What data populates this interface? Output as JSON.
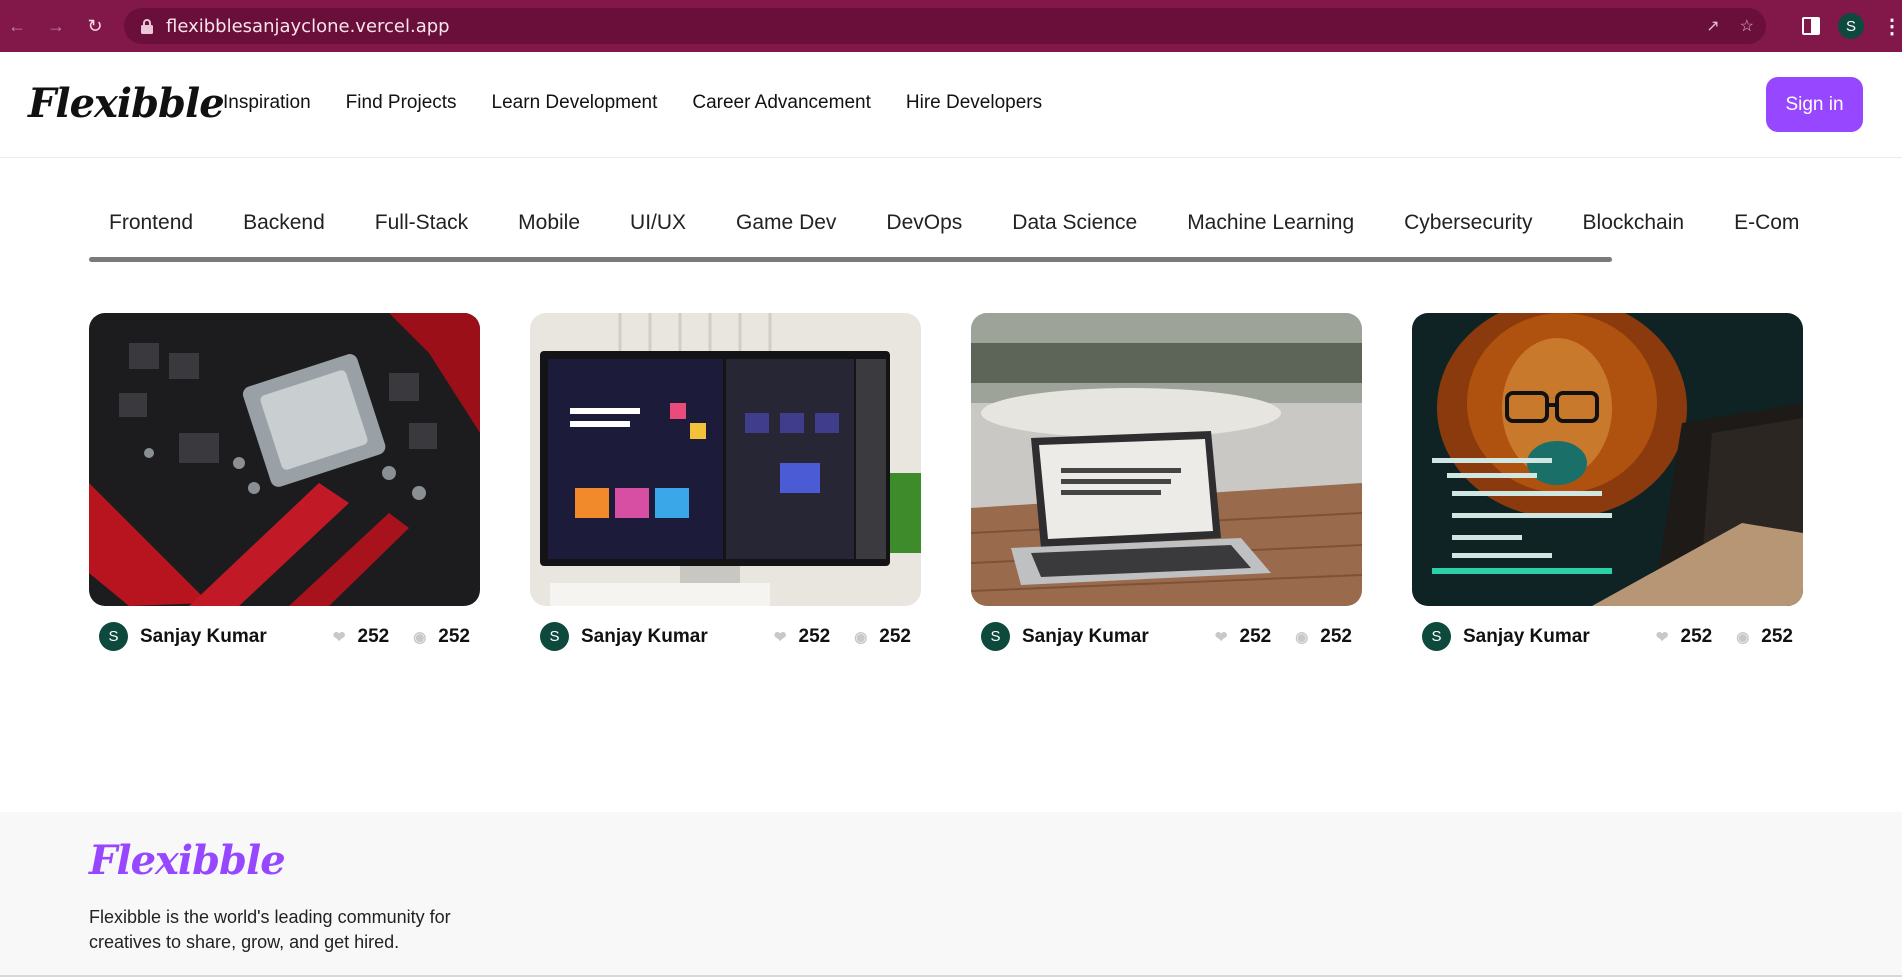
{
  "browser": {
    "url": "flexibblesanjayclone.vercel.app",
    "profile_initial": "S"
  },
  "header": {
    "logo": "Flexibble",
    "nav": [
      "Inspiration",
      "Find Projects",
      "Learn Development",
      "Career Advancement",
      "Hire Developers"
    ],
    "signin_label": "Sign in"
  },
  "categories": [
    "Frontend",
    "Backend",
    "Full-Stack",
    "Mobile",
    "UI/UX",
    "Game Dev",
    "DevOps",
    "Data Science",
    "Machine Learning",
    "Cybersecurity",
    "Blockchain",
    "E-Com"
  ],
  "projects": [
    {
      "image": "circuit-board-cpu",
      "author_initial": "S",
      "author": "Sanjay Kumar",
      "likes": "252",
      "views": "252"
    },
    {
      "image": "monitor-web-design",
      "author_initial": "S",
      "author": "Sanjay Kumar",
      "likes": "252",
      "views": "252"
    },
    {
      "image": "laptop-on-table",
      "author_initial": "S",
      "author": "Sanjay Kumar",
      "likes": "252",
      "views": "252"
    },
    {
      "image": "lion-with-glasses-code",
      "author_initial": "S",
      "author": "Sanjay Kumar",
      "likes": "252",
      "views": "252"
    }
  ],
  "footer": {
    "logo": "Flexibble",
    "tagline": "Flexibble is the world's leading community for creatives to share, grow, and get hired."
  },
  "colors": {
    "browser_bar": "#82174a",
    "accent": "#9747ff",
    "avatar": "#0d4a3d"
  }
}
